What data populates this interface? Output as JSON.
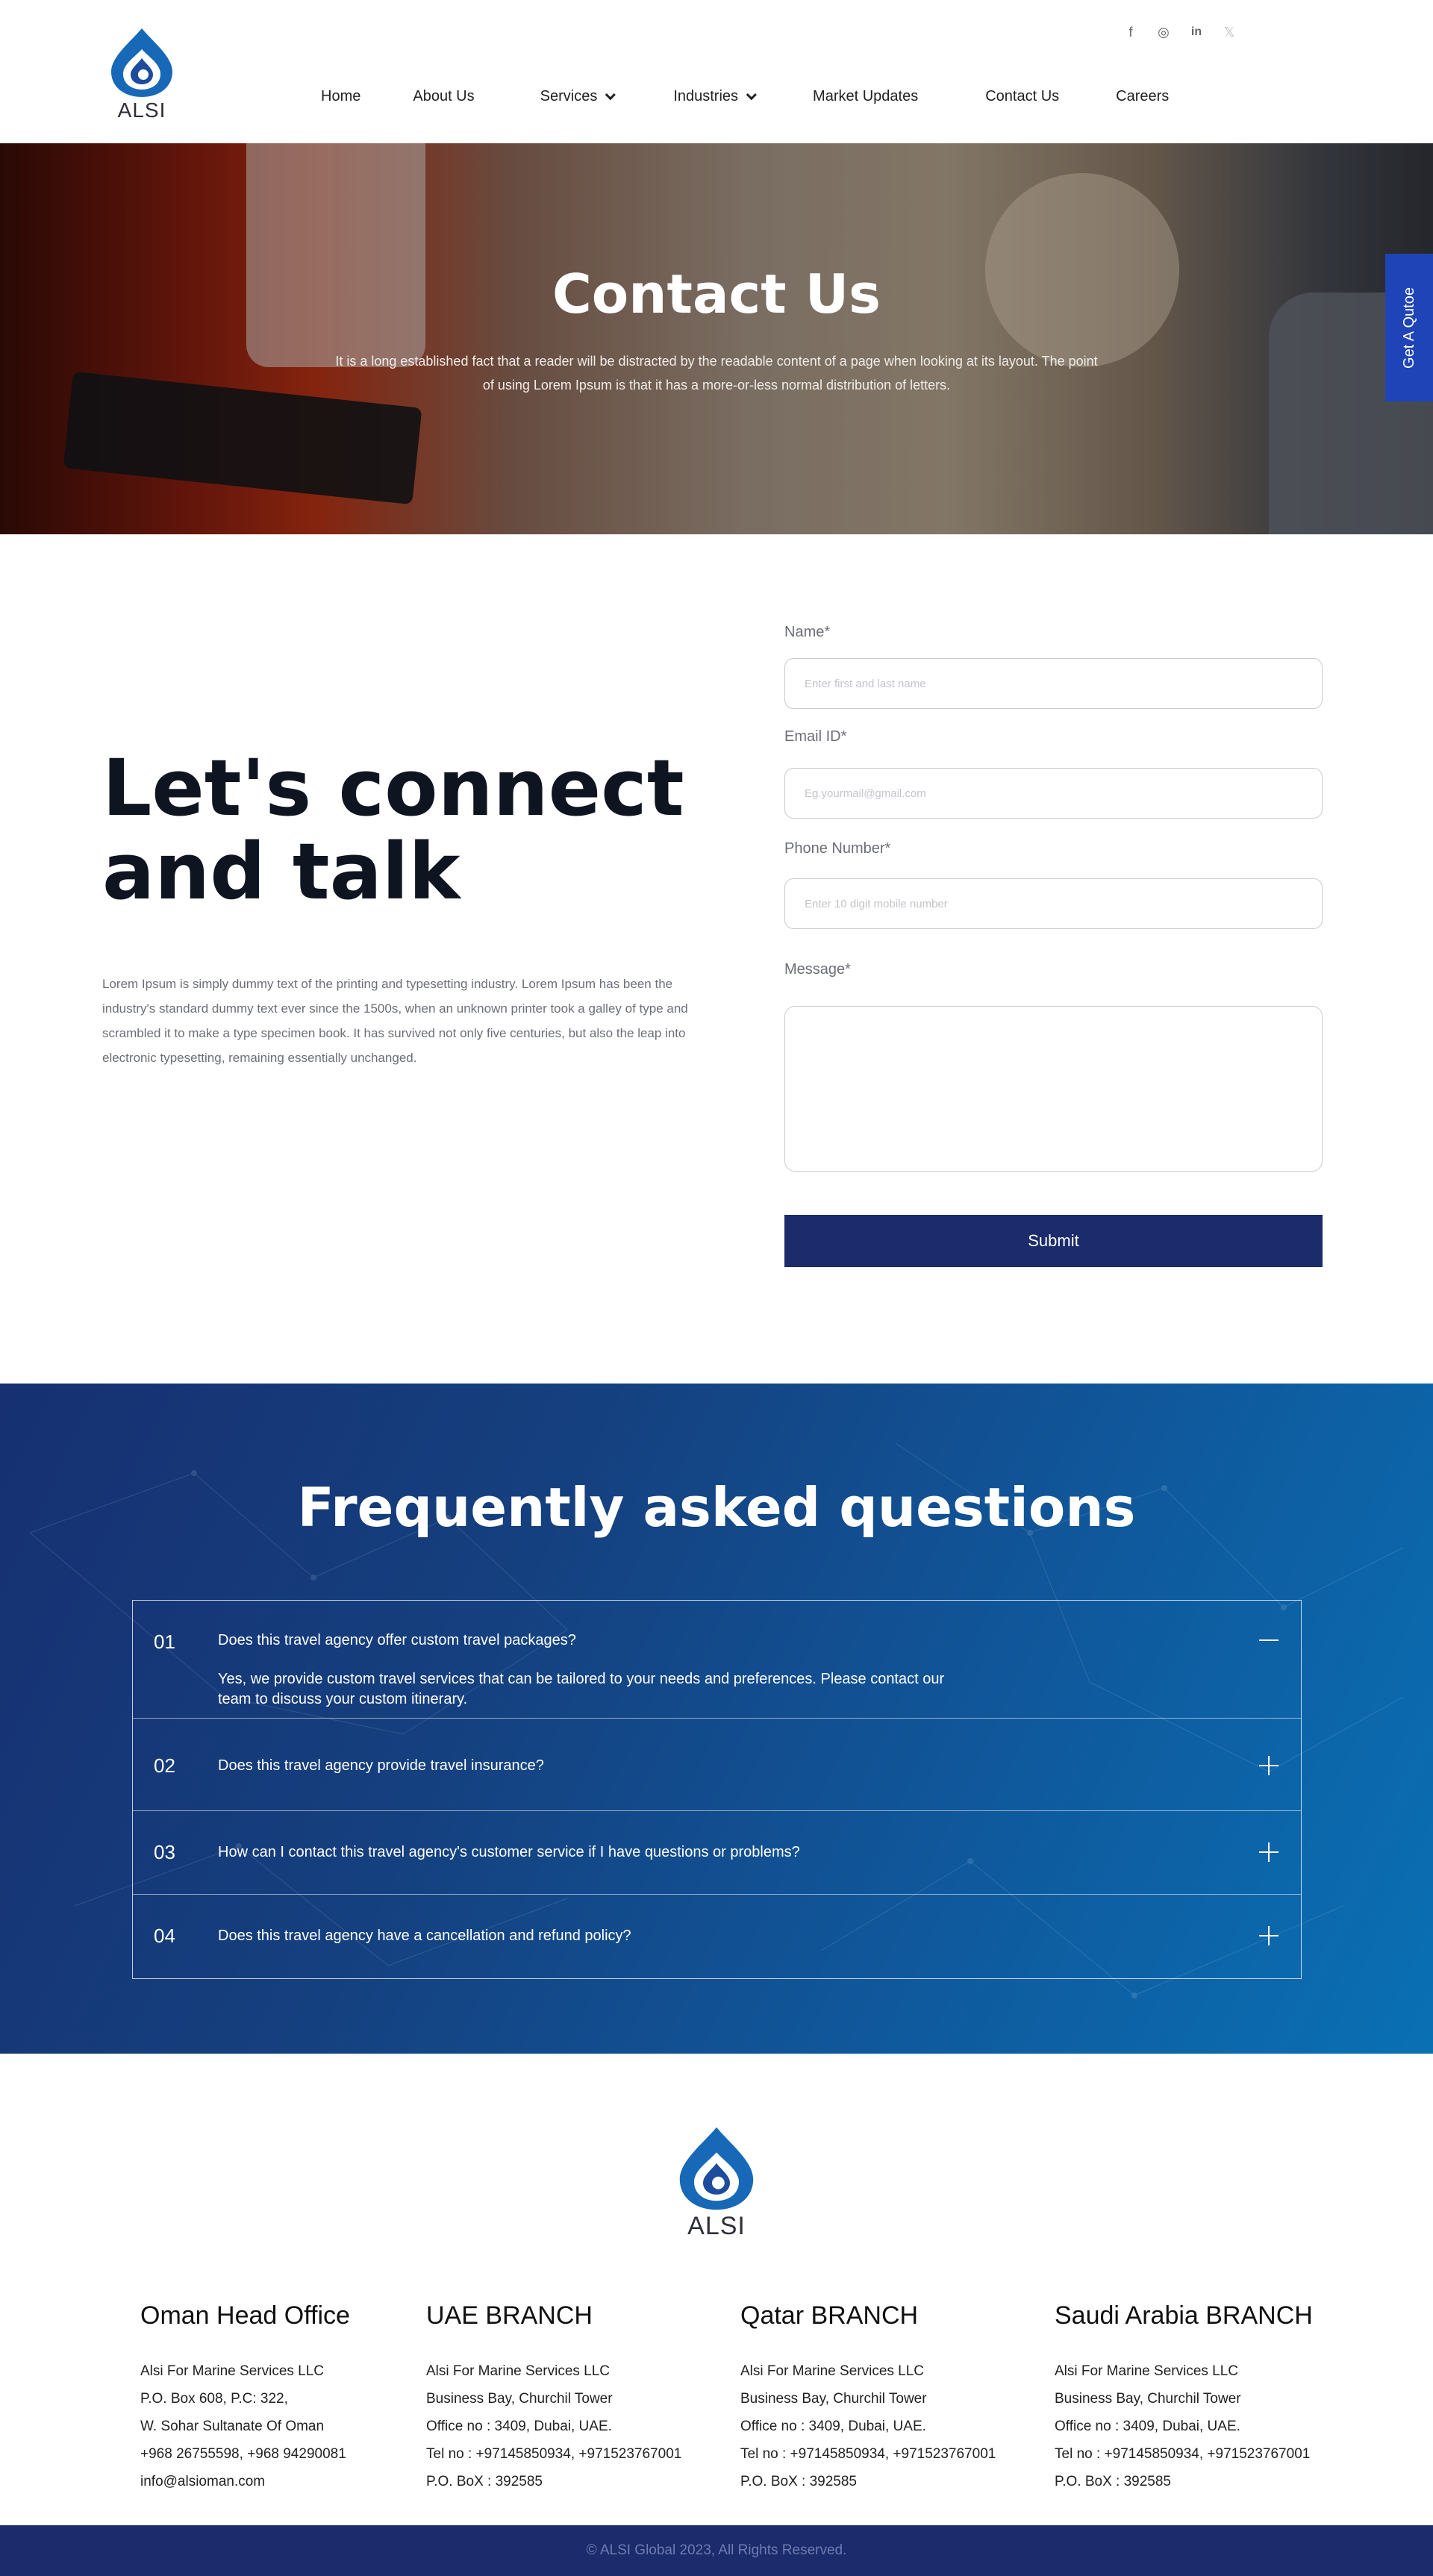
{
  "brand": {
    "name": "ALSI",
    "colors": {
      "navy": "#1b2b6b",
      "quote_tab": "#1e44b8",
      "logo_blue": "#1769b8"
    }
  },
  "social": [
    {
      "name": "facebook-icon",
      "glyph": "f"
    },
    {
      "name": "instagram-icon",
      "glyph": "◎"
    },
    {
      "name": "linkedin-icon",
      "glyph": "in"
    },
    {
      "name": "x-icon",
      "glyph": "𝕏"
    }
  ],
  "nav": {
    "home": "Home",
    "about": "About Us",
    "services": "Services",
    "industries": "Industries",
    "market": "Market Updates",
    "contact": "Contact Us",
    "careers": "Careers"
  },
  "hero": {
    "title": "Contact Us",
    "subtitle": "It is a long established fact that a reader will be distracted by the readable content of a page when looking at its layout. The point of using Lorem Ipsum is that it has a more-or-less normal distribution of letters."
  },
  "quote_tab": "Get A Qutoe",
  "connect": {
    "line1": "Let's connect",
    "line2": "and talk",
    "text": "Lorem Ipsum is simply dummy text of the printing and typesetting industry. Lorem Ipsum has been the industry's standard dummy text ever since the 1500s, when an unknown printer took a galley of type and scrambled it to make a type specimen book. It has survived not only five centuries, but also the leap into electronic typesetting, remaining essentially unchanged."
  },
  "form": {
    "name_label": "Name*",
    "name_placeholder": "Enter first and last name",
    "email_label": "Email ID*",
    "email_placeholder": "Eg.yourmail@gmail.com",
    "phone_label": "Phone Number*",
    "phone_placeholder": "Enter 10 digit mobile number",
    "message_label": "Message*",
    "submit": "Submit"
  },
  "faq": {
    "title": "Frequently asked questions",
    "items": [
      {
        "num": "01",
        "question": "Does this travel agency offer custom travel packages?",
        "answer": "Yes, we provide custom travel services that can be tailored to your needs and preferences. Please contact our team to discuss your custom itinerary.",
        "expanded": true
      },
      {
        "num": "02",
        "question": "Does this travel agency provide travel insurance?",
        "expanded": false
      },
      {
        "num": "03",
        "question": "How can I contact this travel agency's customer service if I have questions or problems?",
        "expanded": false
      },
      {
        "num": "04",
        "question": "Does this travel agency have a cancellation and refund policy?",
        "expanded": false
      }
    ]
  },
  "branches": [
    {
      "title": "Oman Head Office",
      "lines": [
        "Alsi For Marine Services LLC",
        "P.O. Box 608, P.C: 322,",
        "W. Sohar Sultanate Of Oman",
        "+968 26755598, +968 94290081",
        "info@alsioman.com"
      ]
    },
    {
      "title": "UAE BRANCH",
      "lines": [
        "Alsi For Marine Services LLC",
        "Business Bay, Churchil Tower",
        "Office no : 3409, Dubai, UAE.",
        "Tel no : +97145850934, +971523767001",
        "P.O. BoX : 392585"
      ]
    },
    {
      "title": "Qatar BRANCH",
      "lines": [
        "Alsi For Marine Services LLC",
        "Business Bay, Churchil Tower",
        "Office no : 3409, Dubai, UAE.",
        "Tel no : +97145850934, +971523767001",
        "P.O. BoX : 392585"
      ]
    },
    {
      "title": "Saudi Arabia BRANCH",
      "lines": [
        "Alsi For Marine Services LLC",
        "Business Bay, Churchil Tower",
        "Office no : 3409, Dubai, UAE.",
        "Tel no : +97145850934, +971523767001",
        "P.O. BoX : 392585"
      ]
    }
  ],
  "copyright": "© ALSI Global 2023, All Rights Reserved."
}
